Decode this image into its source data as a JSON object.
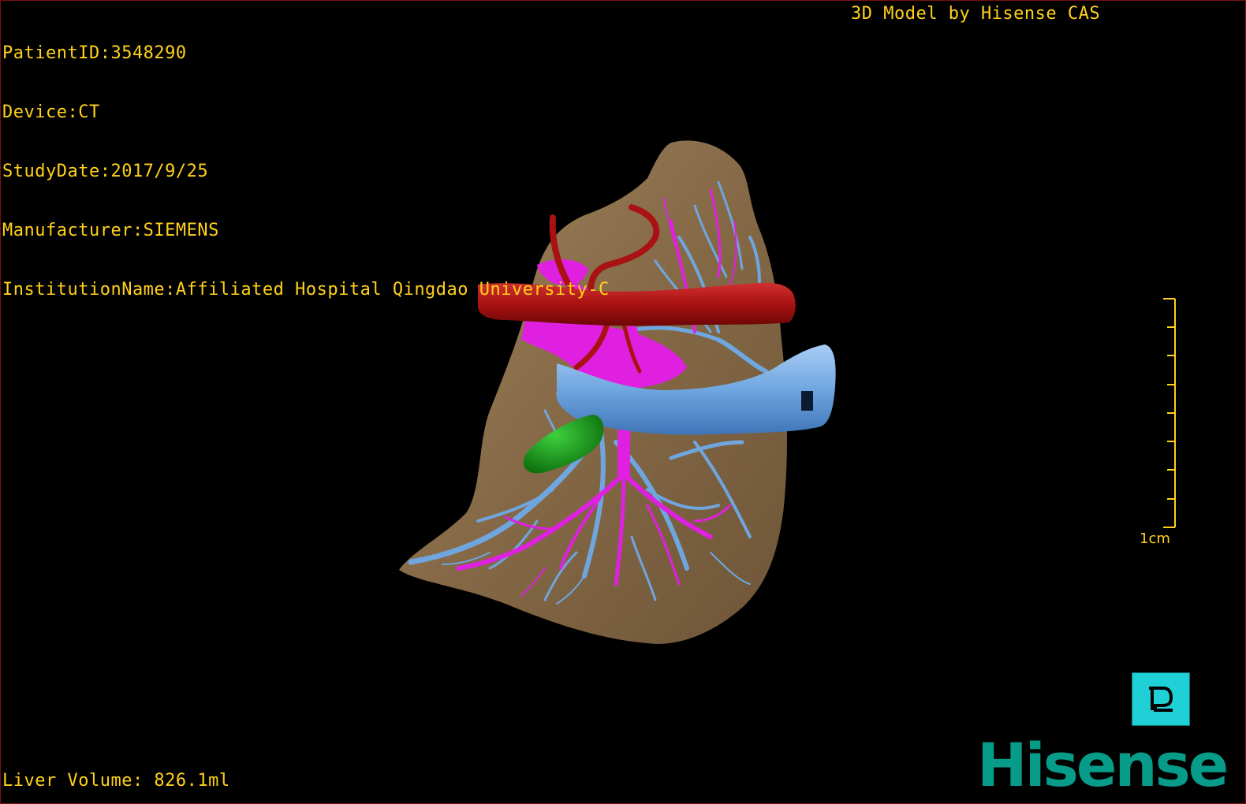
{
  "header": {
    "patient_id": "PatientID:3548290",
    "device": "Device:CT",
    "study_date": "StudyDate:2017/9/25",
    "manufacturer": "Manufacturer:SIEMENS",
    "institution": "InstitutionName:Affiliated Hospital Qingdao University-C"
  },
  "title": "3D Model by Hisense CAS",
  "scale_bar": {
    "label": "1cm"
  },
  "footer": {
    "liver_volume": "Liver Volume: 826.1ml"
  },
  "orientation_cube": {
    "face_letter": "P"
  },
  "logo": {
    "text": "Hisense"
  },
  "colors": {
    "overlay_text": "#ffd11a",
    "liver": "#8a6e4b",
    "artery": "#b01515",
    "portal_vein": "#e020e0",
    "hepatic_vein": "#6fa6e0",
    "gallbladder": "#1a9a1a",
    "cube": "#1fd1d6",
    "logo": "#079b8a"
  }
}
